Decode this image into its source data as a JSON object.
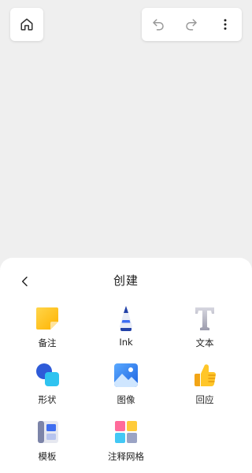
{
  "toolbar": {
    "home_icon": "home-icon",
    "undo_icon": "undo-icon",
    "redo_icon": "redo-icon",
    "more_icon": "more-vertical-icon"
  },
  "sheet": {
    "title": "创建",
    "back_icon": "chevron-left-icon",
    "items": [
      {
        "label": "备注",
        "icon": "sticky-note-icon"
      },
      {
        "label": "Ink",
        "icon": "ink-pen-icon"
      },
      {
        "label": "文本",
        "icon": "text-icon"
      },
      {
        "label": "形状",
        "icon": "shapes-icon"
      },
      {
        "label": "图像",
        "icon": "image-icon"
      },
      {
        "label": "回应",
        "icon": "thumbs-up-icon"
      },
      {
        "label": "模板",
        "icon": "template-icon"
      },
      {
        "label": "注释网格",
        "icon": "annotation-grid-icon"
      }
    ]
  }
}
